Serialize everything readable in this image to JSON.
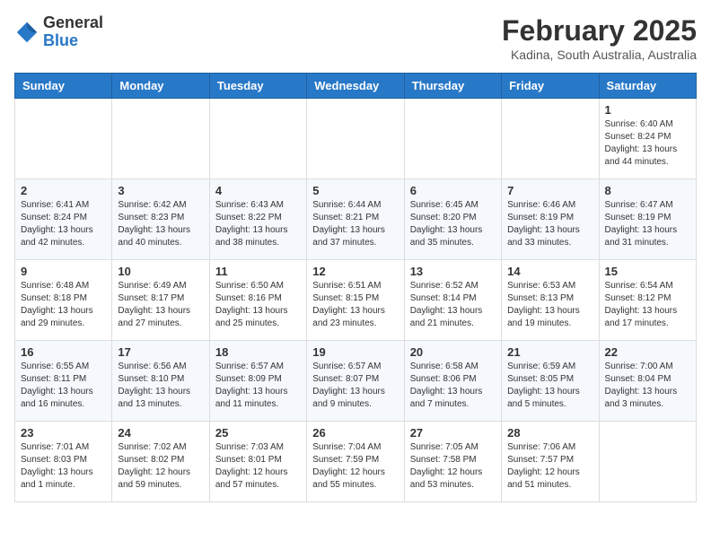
{
  "header": {
    "logo": {
      "general": "General",
      "blue": "Blue"
    },
    "title": "February 2025",
    "location": "Kadina, South Australia, Australia"
  },
  "weekdays": [
    "Sunday",
    "Monday",
    "Tuesday",
    "Wednesday",
    "Thursday",
    "Friday",
    "Saturday"
  ],
  "weeks": [
    [
      {
        "day": "",
        "info": ""
      },
      {
        "day": "",
        "info": ""
      },
      {
        "day": "",
        "info": ""
      },
      {
        "day": "",
        "info": ""
      },
      {
        "day": "",
        "info": ""
      },
      {
        "day": "",
        "info": ""
      },
      {
        "day": "1",
        "info": "Sunrise: 6:40 AM\nSunset: 8:24 PM\nDaylight: 13 hours\nand 44 minutes."
      }
    ],
    [
      {
        "day": "2",
        "info": "Sunrise: 6:41 AM\nSunset: 8:24 PM\nDaylight: 13 hours\nand 42 minutes."
      },
      {
        "day": "3",
        "info": "Sunrise: 6:42 AM\nSunset: 8:23 PM\nDaylight: 13 hours\nand 40 minutes."
      },
      {
        "day": "4",
        "info": "Sunrise: 6:43 AM\nSunset: 8:22 PM\nDaylight: 13 hours\nand 38 minutes."
      },
      {
        "day": "5",
        "info": "Sunrise: 6:44 AM\nSunset: 8:21 PM\nDaylight: 13 hours\nand 37 minutes."
      },
      {
        "day": "6",
        "info": "Sunrise: 6:45 AM\nSunset: 8:20 PM\nDaylight: 13 hours\nand 35 minutes."
      },
      {
        "day": "7",
        "info": "Sunrise: 6:46 AM\nSunset: 8:19 PM\nDaylight: 13 hours\nand 33 minutes."
      },
      {
        "day": "8",
        "info": "Sunrise: 6:47 AM\nSunset: 8:19 PM\nDaylight: 13 hours\nand 31 minutes."
      }
    ],
    [
      {
        "day": "9",
        "info": "Sunrise: 6:48 AM\nSunset: 8:18 PM\nDaylight: 13 hours\nand 29 minutes."
      },
      {
        "day": "10",
        "info": "Sunrise: 6:49 AM\nSunset: 8:17 PM\nDaylight: 13 hours\nand 27 minutes."
      },
      {
        "day": "11",
        "info": "Sunrise: 6:50 AM\nSunset: 8:16 PM\nDaylight: 13 hours\nand 25 minutes."
      },
      {
        "day": "12",
        "info": "Sunrise: 6:51 AM\nSunset: 8:15 PM\nDaylight: 13 hours\nand 23 minutes."
      },
      {
        "day": "13",
        "info": "Sunrise: 6:52 AM\nSunset: 8:14 PM\nDaylight: 13 hours\nand 21 minutes."
      },
      {
        "day": "14",
        "info": "Sunrise: 6:53 AM\nSunset: 8:13 PM\nDaylight: 13 hours\nand 19 minutes."
      },
      {
        "day": "15",
        "info": "Sunrise: 6:54 AM\nSunset: 8:12 PM\nDaylight: 13 hours\nand 17 minutes."
      }
    ],
    [
      {
        "day": "16",
        "info": "Sunrise: 6:55 AM\nSunset: 8:11 PM\nDaylight: 13 hours\nand 16 minutes."
      },
      {
        "day": "17",
        "info": "Sunrise: 6:56 AM\nSunset: 8:10 PM\nDaylight: 13 hours\nand 13 minutes."
      },
      {
        "day": "18",
        "info": "Sunrise: 6:57 AM\nSunset: 8:09 PM\nDaylight: 13 hours\nand 11 minutes."
      },
      {
        "day": "19",
        "info": "Sunrise: 6:57 AM\nSunset: 8:07 PM\nDaylight: 13 hours\nand 9 minutes."
      },
      {
        "day": "20",
        "info": "Sunrise: 6:58 AM\nSunset: 8:06 PM\nDaylight: 13 hours\nand 7 minutes."
      },
      {
        "day": "21",
        "info": "Sunrise: 6:59 AM\nSunset: 8:05 PM\nDaylight: 13 hours\nand 5 minutes."
      },
      {
        "day": "22",
        "info": "Sunrise: 7:00 AM\nSunset: 8:04 PM\nDaylight: 13 hours\nand 3 minutes."
      }
    ],
    [
      {
        "day": "23",
        "info": "Sunrise: 7:01 AM\nSunset: 8:03 PM\nDaylight: 13 hours\nand 1 minute."
      },
      {
        "day": "24",
        "info": "Sunrise: 7:02 AM\nSunset: 8:02 PM\nDaylight: 12 hours\nand 59 minutes."
      },
      {
        "day": "25",
        "info": "Sunrise: 7:03 AM\nSunset: 8:01 PM\nDaylight: 12 hours\nand 57 minutes."
      },
      {
        "day": "26",
        "info": "Sunrise: 7:04 AM\nSunset: 7:59 PM\nDaylight: 12 hours\nand 55 minutes."
      },
      {
        "day": "27",
        "info": "Sunrise: 7:05 AM\nSunset: 7:58 PM\nDaylight: 12 hours\nand 53 minutes."
      },
      {
        "day": "28",
        "info": "Sunrise: 7:06 AM\nSunset: 7:57 PM\nDaylight: 12 hours\nand 51 minutes."
      },
      {
        "day": "",
        "info": ""
      }
    ]
  ]
}
